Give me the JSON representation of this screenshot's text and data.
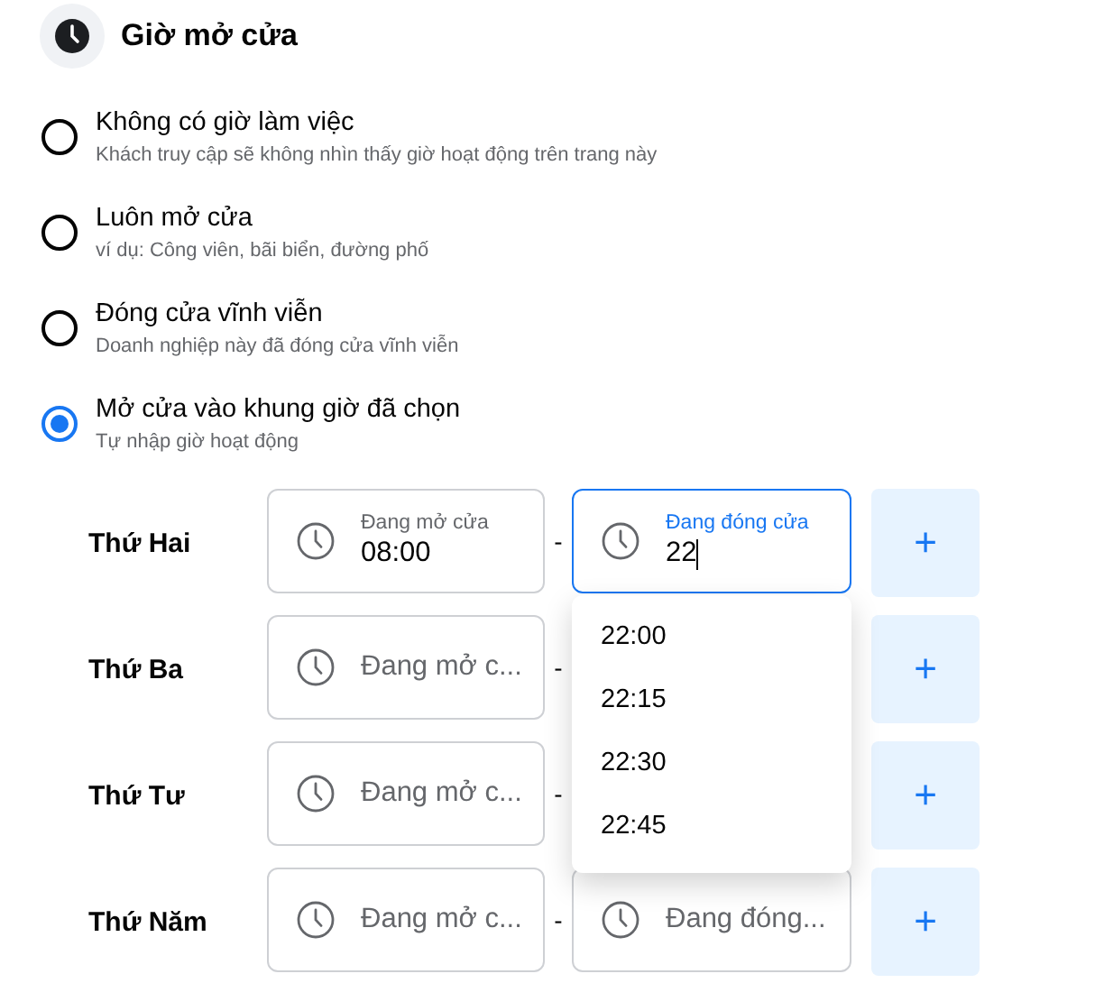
{
  "header": {
    "title": "Giờ mở cửa"
  },
  "options": [
    {
      "title": "Không có giờ làm việc",
      "description": "Khách truy cập sẽ không nhìn thấy giờ hoạt động trên trang này",
      "selected": false
    },
    {
      "title": "Luôn mở cửa",
      "description": "ví dụ: Công viên, bãi biển, đường phố",
      "selected": false
    },
    {
      "title": "Đóng cửa vĩnh viễn",
      "description": "Doanh nghiệp này đã đóng cửa vĩnh viễn",
      "selected": false
    },
    {
      "title": "Mở cửa vào khung giờ đã chọn",
      "description": "Tự nhập giờ hoạt động",
      "selected": true
    }
  ],
  "days": [
    {
      "day": "Thứ Hai",
      "open": {
        "label": "Đang mở cửa",
        "value": "08:00",
        "focused": false
      },
      "close": {
        "label": "Đang đóng cửa",
        "value": "22",
        "focused": true
      },
      "separator": "-",
      "add": "+"
    },
    {
      "day": "Thứ Ba",
      "open": {
        "placeholder": "Đang mở c...",
        "focused": false
      },
      "separator": "-",
      "add": "+"
    },
    {
      "day": "Thứ Tư",
      "open": {
        "placeholder": "Đang mở c...",
        "focused": false
      },
      "separator": "-",
      "add": "+"
    },
    {
      "day": "Thứ Năm",
      "open": {
        "placeholder": "Đang mở c...",
        "focused": false
      },
      "close": {
        "placeholder": "Đang đóng...",
        "focused": false
      },
      "separator": "-",
      "add": "+"
    }
  ],
  "dropdown": {
    "items": [
      "22:00",
      "22:15",
      "22:30",
      "22:45"
    ]
  }
}
